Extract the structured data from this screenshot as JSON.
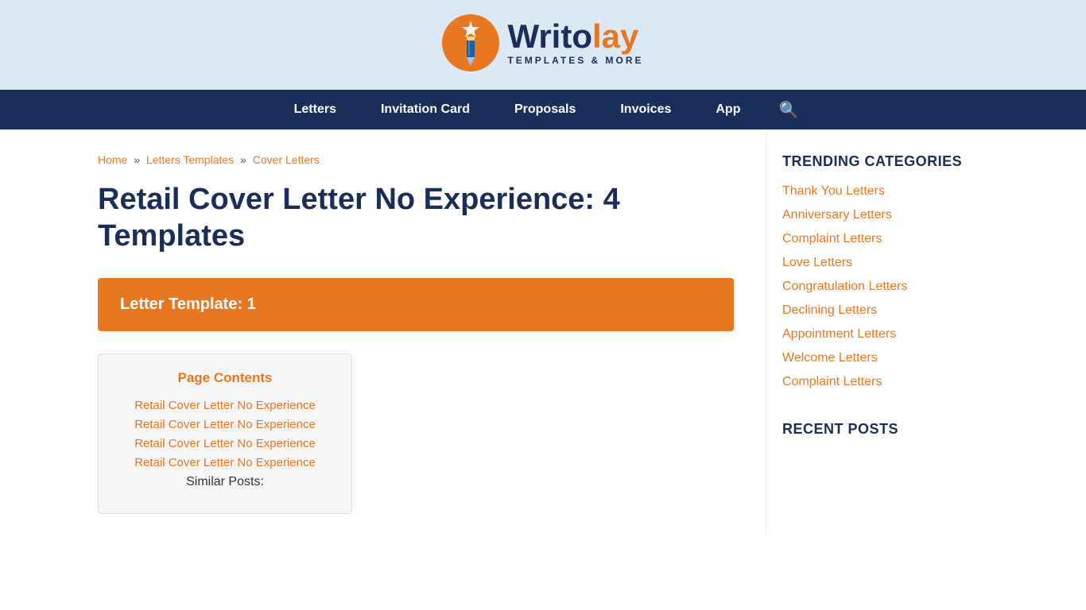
{
  "site": {
    "logo_writo": "Writo",
    "logo_lay": "lay",
    "logo_tagline": "TEMPLATES & MORE"
  },
  "nav": {
    "items": [
      {
        "label": "Letters",
        "href": "#"
      },
      {
        "label": "Invitation Card",
        "href": "#"
      },
      {
        "label": "Proposals",
        "href": "#"
      },
      {
        "label": "Invoices",
        "href": "#"
      },
      {
        "label": "App",
        "href": "#"
      }
    ]
  },
  "breadcrumb": {
    "home": "Home",
    "letters_templates": "Letters Templates",
    "cover_letters": "Cover Letters"
  },
  "main": {
    "page_title": "Retail Cover Letter No Experience: 4 Templates",
    "template_box_label": "Letter Template: 1",
    "page_contents_heading": "Page Contents",
    "contents_links": [
      "Retail Cover Letter No Experience",
      "Retail Cover Letter No Experience",
      "Retail Cover Letter No Experience",
      "Retail Cover Letter No Experience"
    ],
    "similar_posts_label": "Similar Posts:"
  },
  "sidebar": {
    "trending_heading": "TRENDING CATEGORIES",
    "trending_items": [
      "Thank You Letters",
      "Anniversary Letters",
      "Complaint Letters",
      "Love Letters",
      "Congratulation Letters",
      "Declining Letters",
      "Appointment Letters",
      "Welcome Letters",
      "Complaint Letters"
    ],
    "recent_heading": "RECENT POSTS"
  },
  "colors": {
    "orange": "#e87722",
    "navy": "#1a2e5a",
    "header_bg": "#dce9f5"
  }
}
